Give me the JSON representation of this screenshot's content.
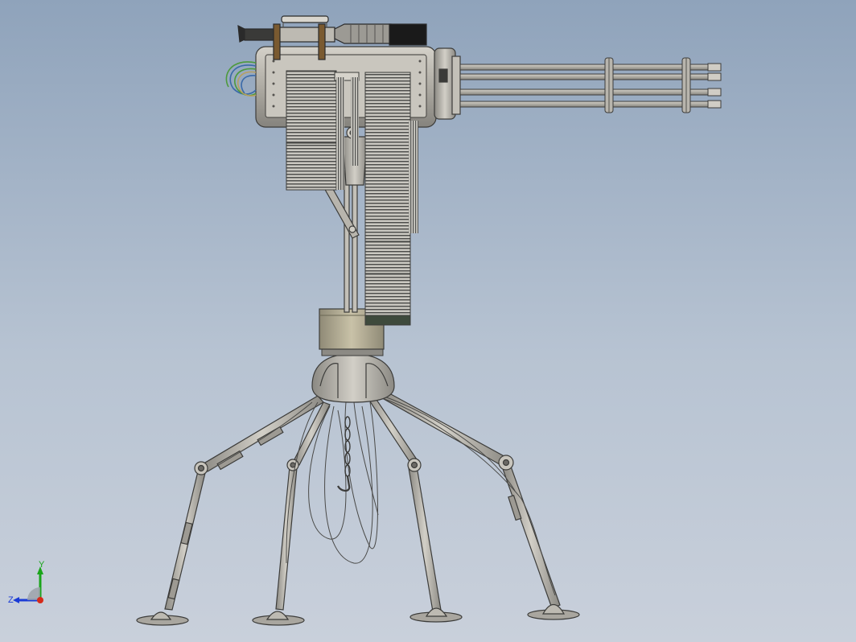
{
  "viewport": {
    "background_top": "#8fa3bb",
    "background_bottom": "#c9d0db"
  },
  "model": {
    "subject": "minigun-turret-on-spider-legs",
    "metal_color": "#b5b2aa",
    "dark_color": "#2a2a2a",
    "brass_color": "#8a6a3a",
    "belt_color": "#9a9a96",
    "base_color": "#a8a08a"
  },
  "triad": {
    "y_label": "Y",
    "z_label": "Z",
    "y_color": "#1aa51a",
    "z_color": "#1a3bd6",
    "x_color": "#d62a1a"
  }
}
